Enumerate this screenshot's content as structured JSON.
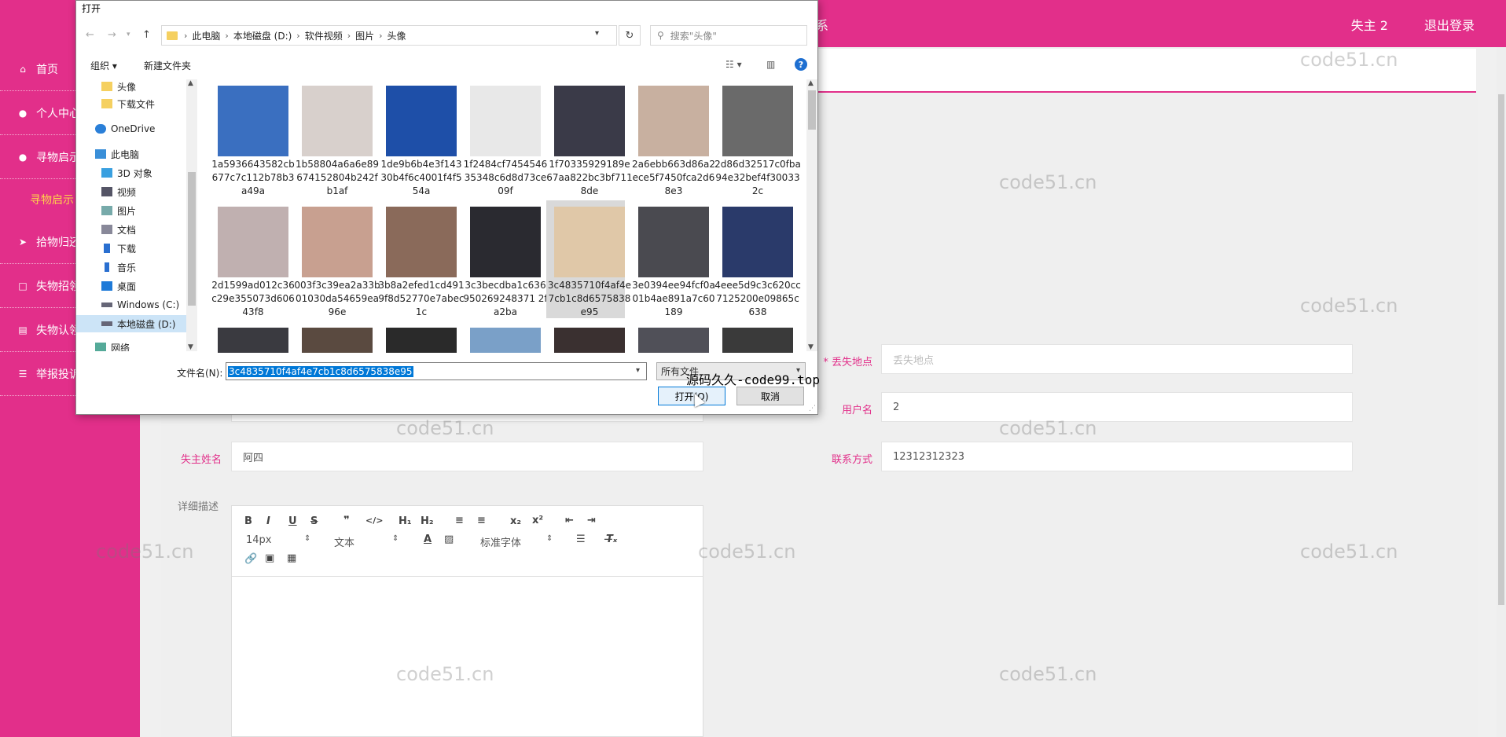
{
  "header": {
    "title_fragment": "系",
    "user": "失主 2",
    "logout": "退出登录"
  },
  "sidebar": {
    "items": [
      {
        "label": "首页",
        "icon": "home-icon"
      },
      {
        "label": "个人中心",
        "icon": "user-icon"
      },
      {
        "label": "寻物启示",
        "icon": "user-icon"
      },
      {
        "label": "拾物归还",
        "icon": "send-icon"
      },
      {
        "label": "失物招领",
        "icon": "square-icon"
      },
      {
        "label": "失物认领",
        "icon": "clipboard-icon"
      },
      {
        "label": "举报投诉",
        "icon": "list-icon"
      }
    ],
    "sub_item": "寻物启示"
  },
  "form": {
    "lost_place_label": "* 丢失地点",
    "lost_place_placeholder": "丢失地点",
    "username_label": "用户名",
    "username_value": "2",
    "owner_name_label": "失主姓名",
    "owner_name_value": "阿四",
    "contact_label": "联系方式",
    "contact_value": "12312312323",
    "detail_label": "详细描述"
  },
  "editor": {
    "font_size": "14px",
    "text_type": "文本",
    "font_family": "标准字体"
  },
  "dialog": {
    "title": "打开",
    "breadcrumbs": [
      "此电脑",
      "本地磁盘 (D:)",
      "软件视频",
      "图片",
      "头像"
    ],
    "search_placeholder": "搜索\"头像\"",
    "organize": "组织 ▾",
    "new_folder": "新建文件夹",
    "nav": [
      "头像",
      "下载文件",
      "OneDrive",
      "此电脑",
      "3D 对象",
      "视频",
      "图片",
      "文档",
      "下载",
      "音乐",
      "桌面",
      "Windows (C:)",
      "本地磁盘 (D:)",
      "网络"
    ],
    "files": [
      {
        "name": "1a5936643582cb677c7c112b78b3a49a",
        "color": "#3a6fc0"
      },
      {
        "name": "1b58804a6a6e89674152804b242fb1af",
        "color": "#d8d0cc"
      },
      {
        "name": "1de9b6b4e3f14330b4f6c4001f4f554a",
        "color": "#1e4fa8"
      },
      {
        "name": "1f2484cf745454635348c6d8d73ce09f",
        "color": "#e8e8e8"
      },
      {
        "name": "1f70335929189e67aa822bc3bf7118de",
        "color": "#3a3a48"
      },
      {
        "name": "2a6ebb663d86a2ece5f7450fca2d68e3",
        "color": "#c8b0a0"
      },
      {
        "name": "2d86d32517c0fba94e32bef4f300332c",
        "color": "#6a6a6a"
      },
      {
        "name": "2d1599ad012c36c29e355073d60643f8",
        "color": "#c0b0b0"
      },
      {
        "name": "003f3c39ea2a33b01030da54659ea96e",
        "color": "#c8a090"
      },
      {
        "name": "3b8a2efed1cd4919f8d52770e7abec1c",
        "color": "#8a6a5a"
      },
      {
        "name": "3c3becdba1c636950269248371 2fa2ba",
        "color": "#2a2a30"
      },
      {
        "name": "3c4835710f4af4e7cb1c8d6575838e95",
        "color": "#e0c8a8"
      },
      {
        "name": "3e0394ee94fcf0a01b4ae891a7c60189",
        "color": "#4a4a50"
      },
      {
        "name": "4eee5d9c3c620cc7125200e09865c638",
        "color": "#2a3a6a"
      }
    ],
    "filename_label": "文件名(N):",
    "filename_value": "3c4835710f4af4e7cb1c8d6575838e95",
    "filetype": "所有文件",
    "open_button": "打开(O)",
    "cancel_button": "取消"
  },
  "overlay_text": "源码久久-code99.top",
  "watermark": "code51.cn"
}
